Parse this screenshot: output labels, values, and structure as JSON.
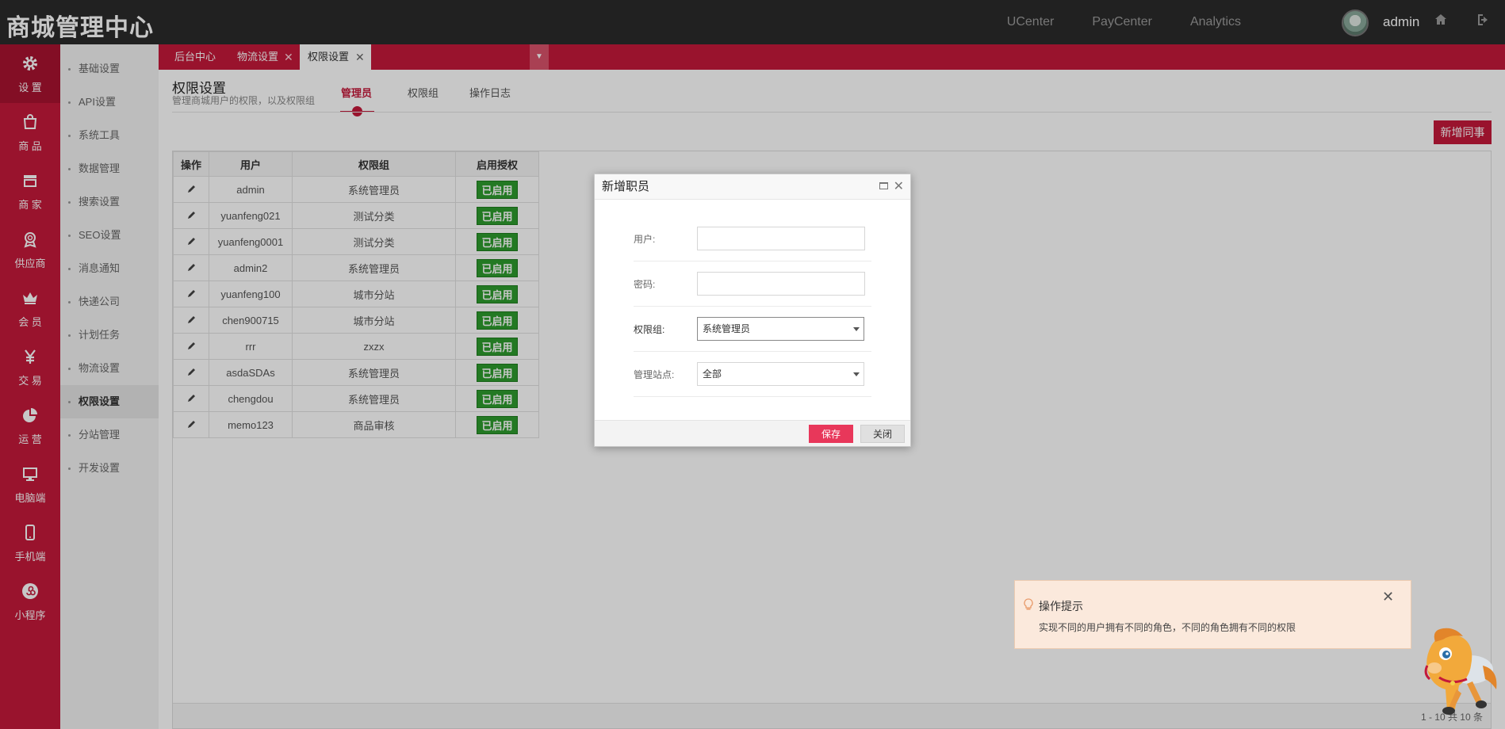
{
  "header": {
    "brand": "商城管理中心",
    "links": [
      "UCenter",
      "PayCenter",
      "Analytics"
    ],
    "username": "admin"
  },
  "mainnav": [
    {
      "label": "设 置",
      "icon": "gear-icon",
      "active": true
    },
    {
      "label": "商 品",
      "icon": "bag-icon"
    },
    {
      "label": "商 家",
      "icon": "store-icon"
    },
    {
      "label": "供应商",
      "icon": "badge-icon"
    },
    {
      "label": "会 员",
      "icon": "crown-icon"
    },
    {
      "label": "交 易",
      "icon": "yen-icon"
    },
    {
      "label": "运 营",
      "icon": "pie-chart-icon"
    },
    {
      "label": "电脑端",
      "icon": "monitor-icon"
    },
    {
      "label": "手机端",
      "icon": "phone-icon"
    },
    {
      "label": "小程序",
      "icon": "mini-program-icon"
    }
  ],
  "subnav": [
    "基础设置",
    "API设置",
    "系统工具",
    "数据管理",
    "搜索设置",
    "SEO设置",
    "消息通知",
    "快递公司",
    "计划任务",
    "物流设置",
    "权限设置",
    "分站管理",
    "开发设置"
  ],
  "tabs": [
    {
      "label": "后台中心"
    },
    {
      "label": "物流设置"
    },
    {
      "label": "权限设置"
    }
  ],
  "page": {
    "title": "权限设置",
    "subtitle": "管理商城用户的权限，以及权限组",
    "tabs": [
      "管理员",
      "权限组",
      "操作日志"
    ],
    "add_button": "新增同事"
  },
  "table": {
    "columns": [
      "操作",
      "用户",
      "权限组",
      "启用授权"
    ],
    "rows": [
      {
        "user": "admin",
        "group": "系统管理员",
        "status": "已启用"
      },
      {
        "user": "yuanfeng021",
        "group": "测试分类",
        "status": "已启用"
      },
      {
        "user": "yuanfeng0001",
        "group": "测试分类",
        "status": "已启用"
      },
      {
        "user": "admin2",
        "group": "系统管理员",
        "status": "已启用"
      },
      {
        "user": "yuanfeng100",
        "group": "城市分站",
        "status": "已启用"
      },
      {
        "user": "chen900715",
        "group": "城市分站",
        "status": "已启用"
      },
      {
        "user": "rrr",
        "group": "zxzx",
        "status": "已启用"
      },
      {
        "user": "asdaSDAs",
        "group": "系统管理员",
        "status": "已启用"
      },
      {
        "user": "chengdou",
        "group": "系统管理员",
        "status": "已启用"
      },
      {
        "user": "memo123",
        "group": "商品审核",
        "status": "已启用"
      }
    ],
    "pager": "1 - 10 共 10 条"
  },
  "modal": {
    "title": "新增职员",
    "fields": {
      "user_label": "用户:",
      "user_value": "",
      "password_label": "密码:",
      "password_value": "",
      "group_label": "权限组:",
      "group_value": "系统管理员",
      "site_label": "管理站点:",
      "site_value": "全部"
    },
    "save": "保存",
    "close": "关闭"
  },
  "tip": {
    "title": "操作提示",
    "body": "实现不同的用户拥有不同的角色，不同的角色拥有不同的权限"
  },
  "colors": {
    "accent": "#c4193a",
    "topbar": "#2b2b2b",
    "status_green": "#2e9b2e",
    "save_button": "#e8375a"
  }
}
